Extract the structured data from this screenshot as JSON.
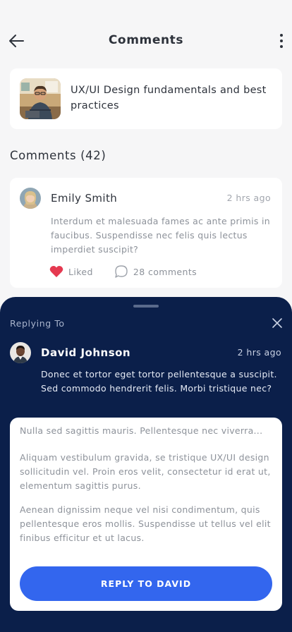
{
  "header": {
    "title": "Comments",
    "back_icon": "arrow-left-icon",
    "more_icon": "more-vertical-icon"
  },
  "course": {
    "title": "UX/UI Design fundamentals and best practices"
  },
  "comments_section": {
    "heading": "Comments (42)"
  },
  "comment": {
    "author": "Emily Smith",
    "time": "2 hrs ago",
    "text": "Interdum et malesuada fames ac ante primis in faucibus. Suspendisse nec felis quis lectus imperdiet suscipit?",
    "like_label": "Liked",
    "comments_label": "28 comments",
    "like_color": "#e53950"
  },
  "reply_sheet": {
    "label": "Replying To",
    "author": "David Johnson",
    "time": "2 hrs ago",
    "text": "Donec et tortor eget tortor pellentesque a suscipit. Sed commodo hendrerit felis. Morbi tristique nec?",
    "background": "#0b1f4a"
  },
  "compose": {
    "preview": "Nulla sed sagittis mauris. Pellentesque nec viverra...",
    "paragraph_1": "Aliquam vestibulum gravida, se tristique UX/UI design sollicitudin vel. Proin eros velit, consectetur id erat ut, elementum sagittis purus.",
    "paragraph_2": "Aenean dignissim neque vel nisi condimentum, quis pellentesque eros mollis. Suspendisse ut tellus vel elit finibus efficitur et ut lacus.",
    "button_label": "REPLY TO DAVID",
    "button_color": "#3366ee"
  }
}
